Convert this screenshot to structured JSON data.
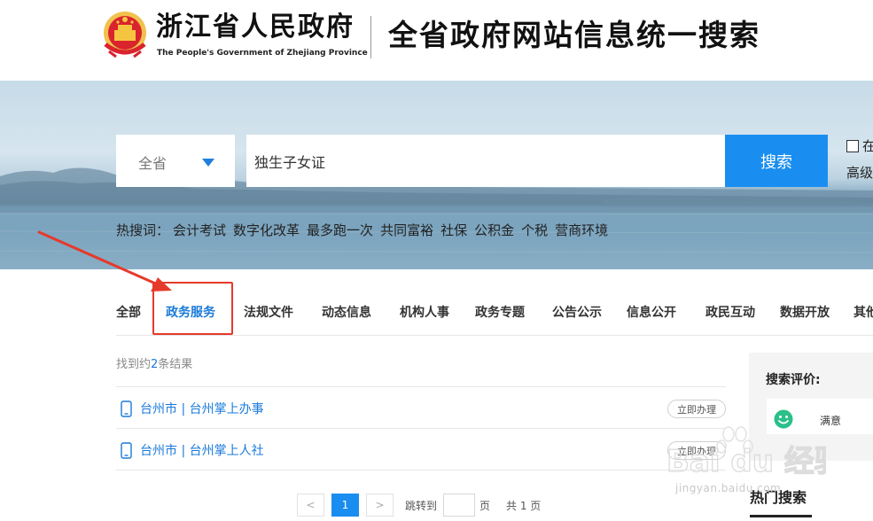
{
  "header": {
    "brand_title": "浙江省人民政府",
    "brand_subtitle": "The People's Government of Zhejiang Province",
    "site_title": "全省政府网站信息统一搜索",
    "emblem_icon": "national-emblem-icon"
  },
  "search": {
    "scope_label": "全省",
    "query": "独生子女证",
    "placeholder": "独生子女证",
    "button_label": "搜索",
    "in_result_label": "在",
    "advanced_label": "高级"
  },
  "hotwords": {
    "label": "热搜词：",
    "items": [
      "会计考试",
      "数字化改革",
      "最多跑一次",
      "共同富裕",
      "社保",
      "公积金",
      "个税",
      "营商环境"
    ]
  },
  "tabs": [
    {
      "label": "全部"
    },
    {
      "label": "政务服务",
      "active": true
    },
    {
      "label": "法规文件"
    },
    {
      "label": "动态信息"
    },
    {
      "label": "机构人事"
    },
    {
      "label": "政务专题"
    },
    {
      "label": "公告公示"
    },
    {
      "label": "信息公开"
    },
    {
      "label": "政民互动"
    },
    {
      "label": "数据开放"
    },
    {
      "label": "其他"
    }
  ],
  "results": {
    "count_prefix": "找到约",
    "count": "2",
    "count_suffix": "条结果",
    "items": [
      {
        "title": "台州市 | 台州掌上办事",
        "action": "立即办理",
        "icon": "mobile-phone-icon"
      },
      {
        "title": "台州市 | 台州掌上人社",
        "action": "立即办理",
        "icon": "mobile-phone-icon"
      }
    ]
  },
  "pagination": {
    "prev": "<",
    "current": "1",
    "next": ">",
    "jump_label": "跳转到",
    "page_unit": "页",
    "total": "共 1 页"
  },
  "sidebar": {
    "rating_title": "搜索评价:",
    "rating_option": "满意",
    "rating_icon": "smiley-face-icon",
    "hot_search_title": "热门搜索"
  },
  "watermark": {
    "brand": "Bai du 经验",
    "domain": "jingyan.baidu.com"
  },
  "colors": {
    "accent": "#1a8ef0",
    "link": "#1a7ad9",
    "highlight_annotation": "#e53a2b",
    "smiley": "#2bbf8a"
  }
}
